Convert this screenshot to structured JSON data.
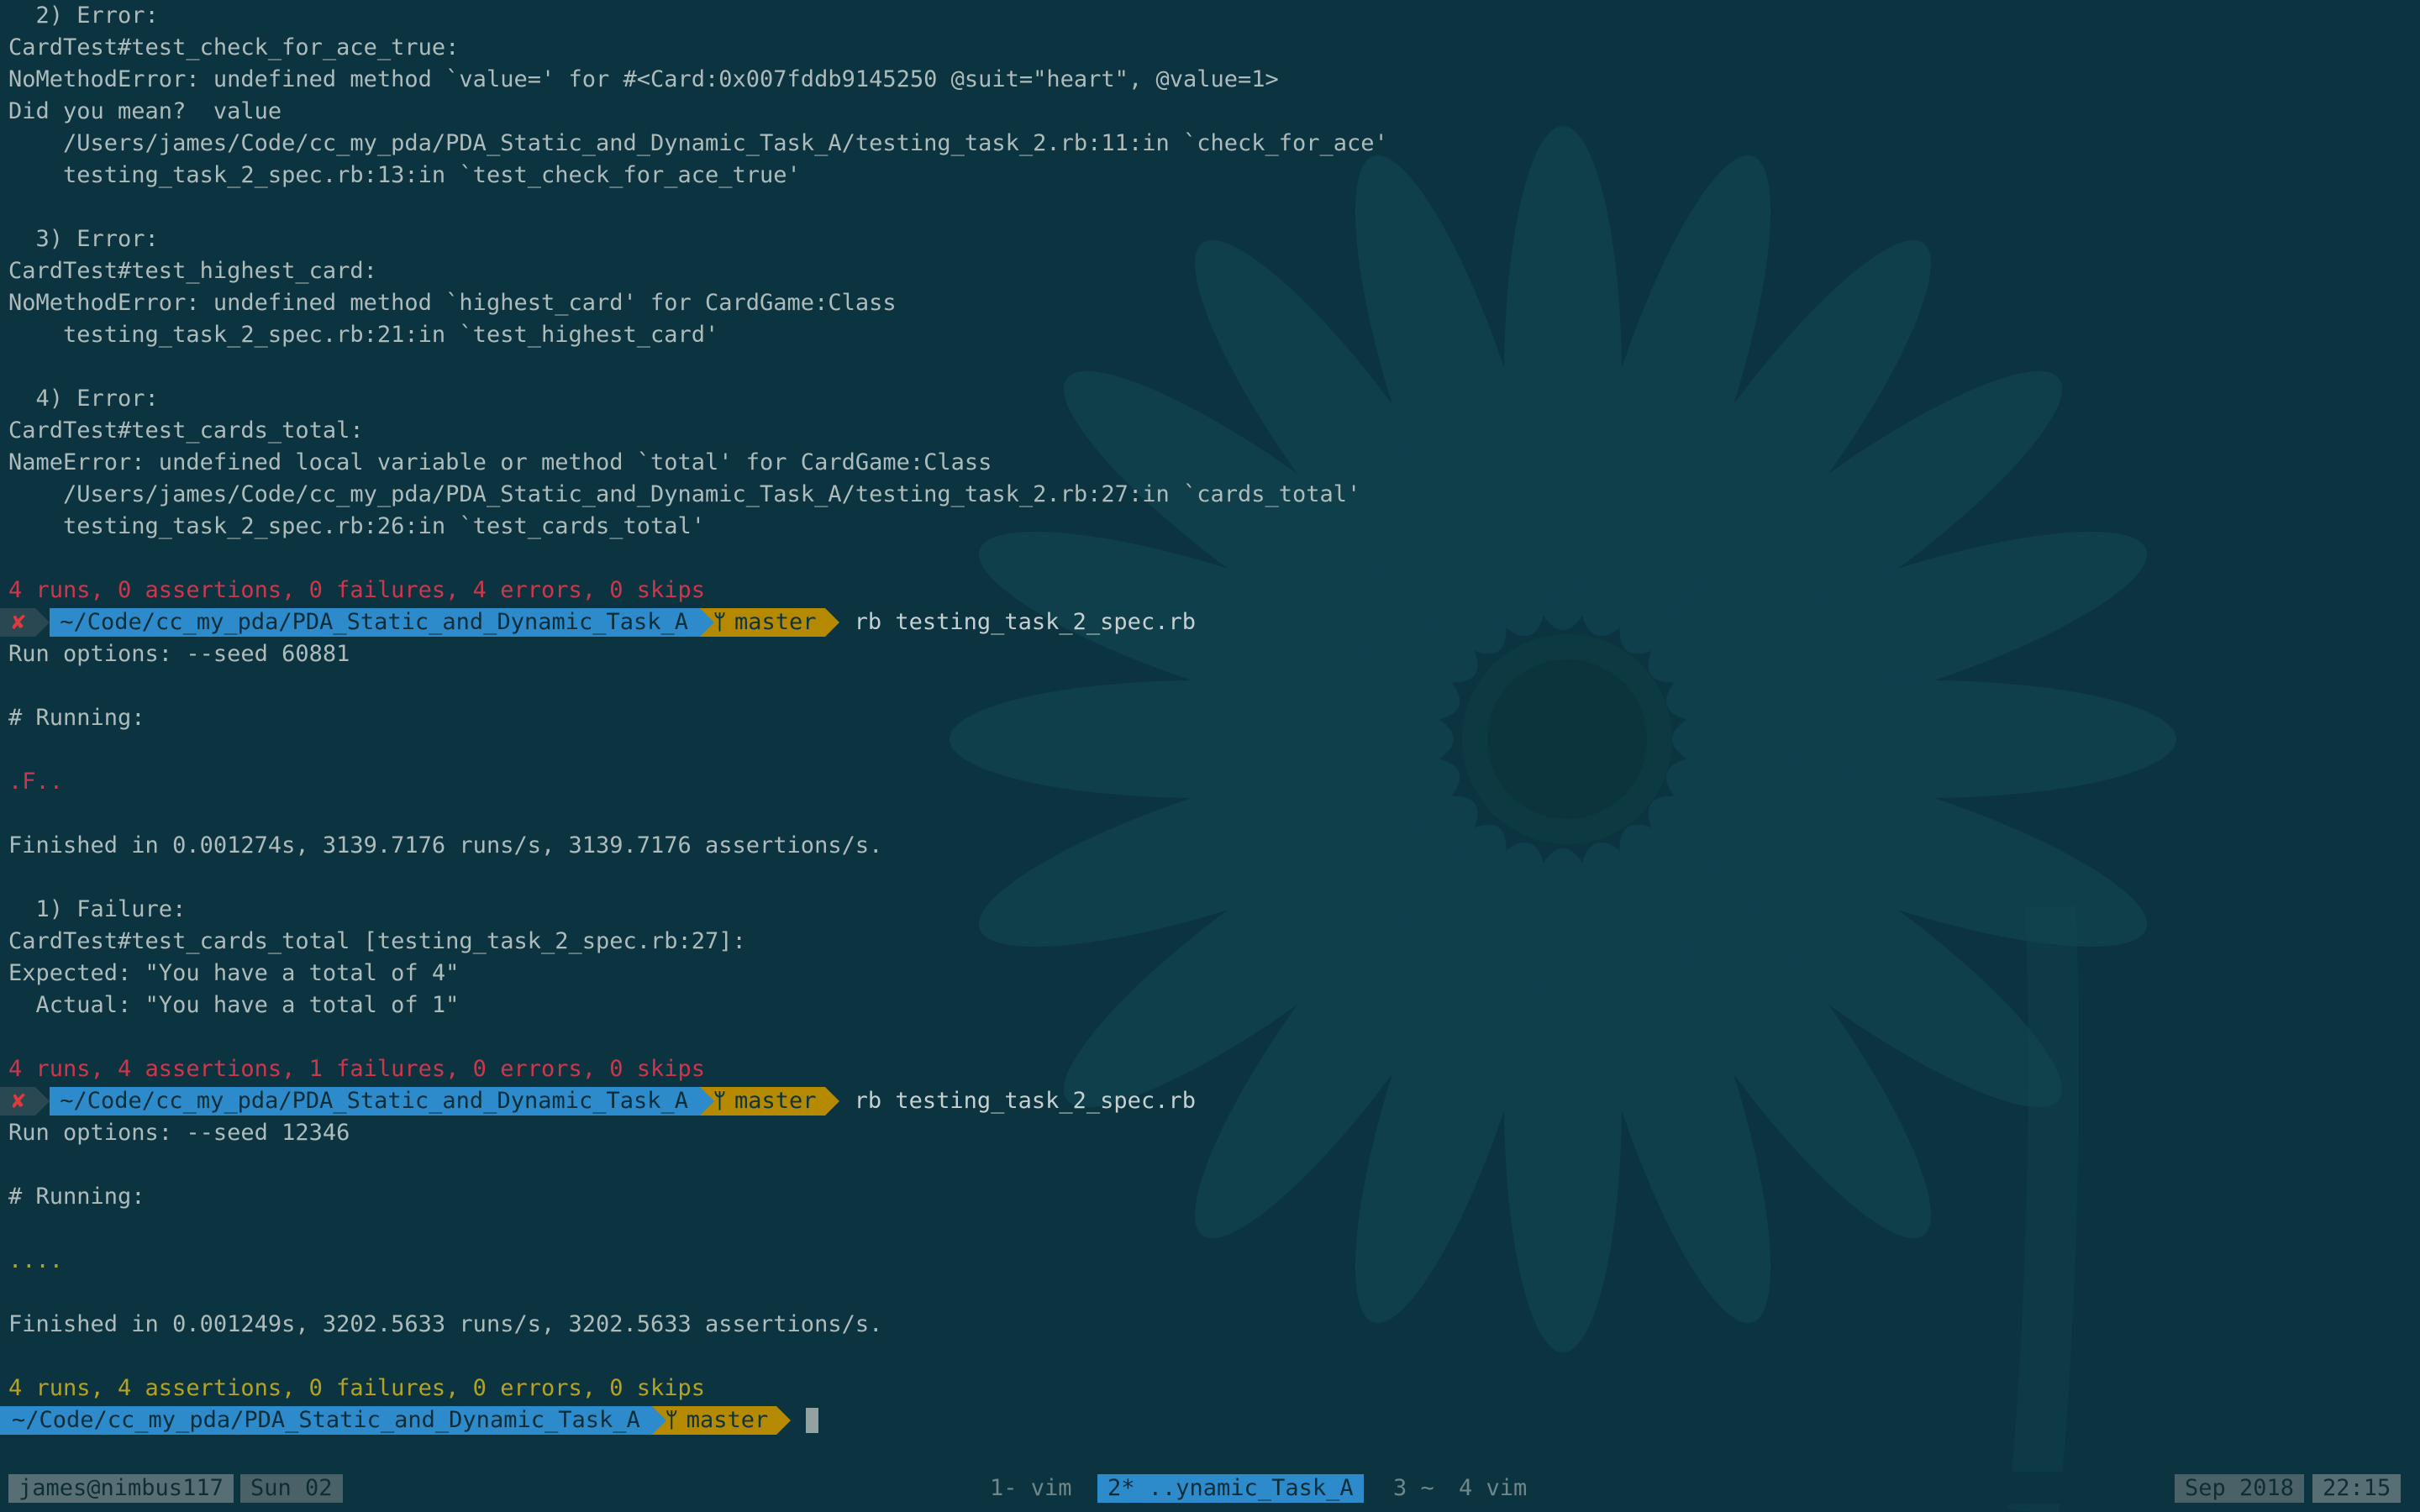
{
  "colors": {
    "background": "#0c3440",
    "text": "#aebbbb",
    "error_red": "#d0364b",
    "success_yellow": "#b6a221",
    "path_blue": "#2e8bcb",
    "git_gold": "#b58900"
  },
  "terminal": {
    "l01": "  2) Error:",
    "l02": "CardTest#test_check_for_ace_true:",
    "l03": "NoMethodError: undefined method `value=' for #<Card:0x007fddb9145250 @suit=\"heart\", @value=1>",
    "l04": "Did you mean?  value",
    "l05": "    /Users/james/Code/cc_my_pda/PDA_Static_and_Dynamic_Task_A/testing_task_2.rb:11:in `check_for_ace'",
    "l06": "    testing_task_2_spec.rb:13:in `test_check_for_ace_true'",
    "l08": "  3) Error:",
    "l09": "CardTest#test_highest_card:",
    "l10": "NoMethodError: undefined method `highest_card' for CardGame:Class",
    "l11": "    testing_task_2_spec.rb:21:in `test_highest_card'",
    "l13": "  4) Error:",
    "l14": "CardTest#test_cards_total:",
    "l15": "NameError: undefined local variable or method `total' for CardGame:Class",
    "l16": "    /Users/james/Code/cc_my_pda/PDA_Static_and_Dynamic_Task_A/testing_task_2.rb:27:in `cards_total'",
    "l17": "    testing_task_2_spec.rb:26:in `test_cards_total'",
    "l19": "4 runs, 0 assertions, 0 failures, 4 errors, 0 skips",
    "l21": "Run options: --seed 60881",
    "l23": "# Running:",
    "l25": ".F..",
    "l27": "Finished in 0.001274s, 3139.7176 runs/s, 3139.7176 assertions/s.",
    "l29": "  1) Failure:",
    "l30": "CardTest#test_cards_total [testing_task_2_spec.rb:27]:",
    "l31": "Expected: \"You have a total of 4\"",
    "l32": "  Actual: \"You have a total of 1\"",
    "l34": "4 runs, 4 assertions, 1 failures, 0 errors, 0 skips",
    "l36": "Run options: --seed 12346",
    "l38": "# Running:",
    "l40": "....",
    "l42": "Finished in 0.001249s, 3202.5633 runs/s, 3202.5633 assertions/s.",
    "l44": "4 runs, 4 assertions, 0 failures, 0 errors, 0 skips"
  },
  "prompt": {
    "error_mark": "✘",
    "path": "~/Code/cc_my_pda/PDA_Static_and_Dynamic_Task_A",
    "branch_icon": "git-branch-icon",
    "branch": "master",
    "command": "rb testing_task_2_spec.rb"
  },
  "status_bar": {
    "user_host": "james@nimbus117",
    "day": "Sun 02",
    "window1": "1- vim",
    "window2": "2* ..ynamic_Task_A",
    "window3": "3 ~",
    "window4": "4 vim",
    "month": "Sep 2018",
    "time": "22:15"
  }
}
